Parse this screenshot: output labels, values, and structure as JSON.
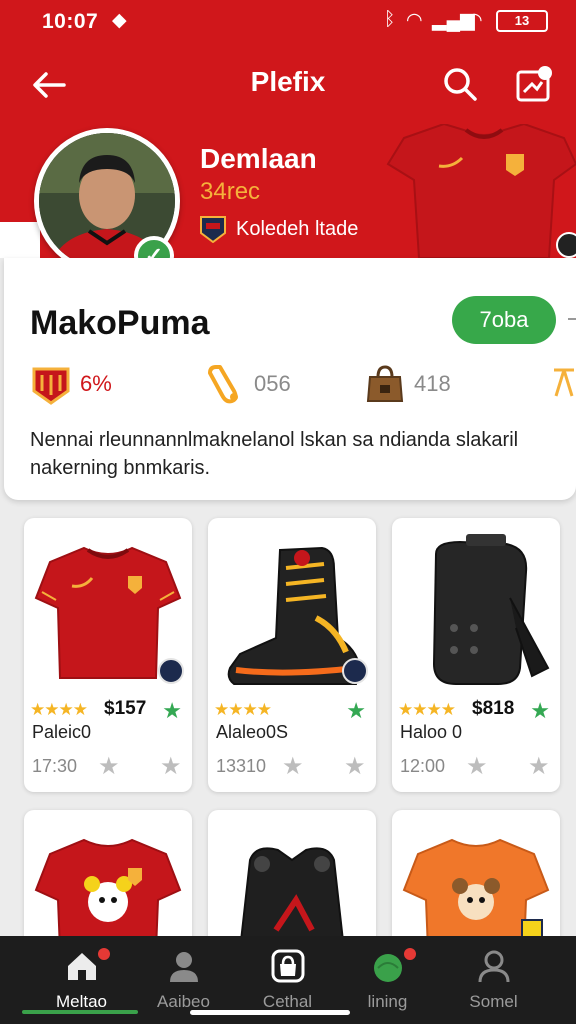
{
  "status_bar": {
    "time": "10:07",
    "battery": "13"
  },
  "app_bar": {
    "title": "Plefix"
  },
  "header": {
    "name": "Demlaan",
    "subtitle": "34rec",
    "club_label": "Koledeh ltade"
  },
  "profile": {
    "username": "MakoPuma",
    "follow_label": "7oba",
    "stats": [
      {
        "value": "6%",
        "icon": "club-crest-icon"
      },
      {
        "value": "056",
        "icon": "horn-icon"
      },
      {
        "value": "418",
        "icon": "bag-icon"
      }
    ],
    "bio": "Nennai rleunnannlmaknelanol lskan sa ndianda slakaril nakerning bnmkaris."
  },
  "products": [
    {
      "name": "Paleic0",
      "price": "$157",
      "rating": "★★★★",
      "meta": "17:30",
      "image": "red-jersey"
    },
    {
      "name": "Alaleo0S",
      "price": "",
      "rating": "★★★★",
      "meta": "13310",
      "image": "boot"
    },
    {
      "name": "Haloo 0",
      "price": "$818",
      "rating": "★★★★",
      "meta": "12:00",
      "image": "shin-guard"
    },
    {
      "name": "",
      "price": "",
      "rating": "",
      "meta": "",
      "image": "red-mascot-jersey"
    },
    {
      "name": "",
      "price": "",
      "rating": "",
      "meta": "",
      "image": "black-gear"
    },
    {
      "name": "",
      "price": "",
      "rating": "",
      "meta": "",
      "image": "orange-mascot-jersey"
    }
  ],
  "bottom_nav": [
    {
      "label": "Meltao",
      "icon": "home-icon",
      "active": true
    },
    {
      "label": "Aaibeo",
      "icon": "person-icon",
      "active": false
    },
    {
      "label": "Cethal",
      "icon": "bag-icon",
      "active": false
    },
    {
      "label": "lining",
      "icon": "ball-icon",
      "active": false
    },
    {
      "label": "Somel",
      "icon": "profile-icon",
      "active": false
    }
  ],
  "colors": {
    "brand_red": "#d0171b",
    "accent_green": "#37a84a",
    "gold": "#f5b13b",
    "nav_bg": "#1d1d1d"
  }
}
